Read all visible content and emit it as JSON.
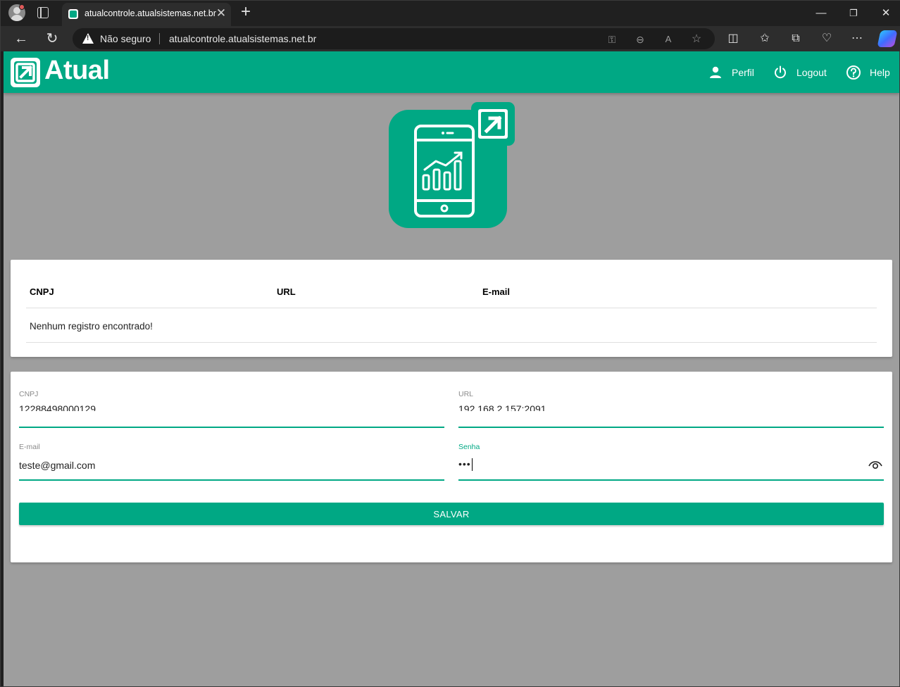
{
  "browser": {
    "tab_title": "atualcontrole.atualsistemas.net.br",
    "security_label": "Não seguro",
    "url": "atualcontrole.atualsistemas.net.br"
  },
  "app": {
    "logo_text": "Atual",
    "brand_color": "#00a884",
    "nav": {
      "perfil": "Perfil",
      "logout": "Logout",
      "help": "Help"
    }
  },
  "table": {
    "columns": [
      "CNPJ",
      "URL",
      "E-mail"
    ],
    "empty_message": "Nenhum registro encontrado!"
  },
  "form": {
    "cnpj": {
      "label": "CNPJ",
      "value": "12288498000129"
    },
    "url": {
      "label": "URL",
      "value": "192.168.2.157:2091"
    },
    "email": {
      "label": "E-mail",
      "value": "teste@gmail.com"
    },
    "senha": {
      "label": "Senha",
      "masked_value": "•••"
    },
    "save_label": "SALVAR"
  }
}
